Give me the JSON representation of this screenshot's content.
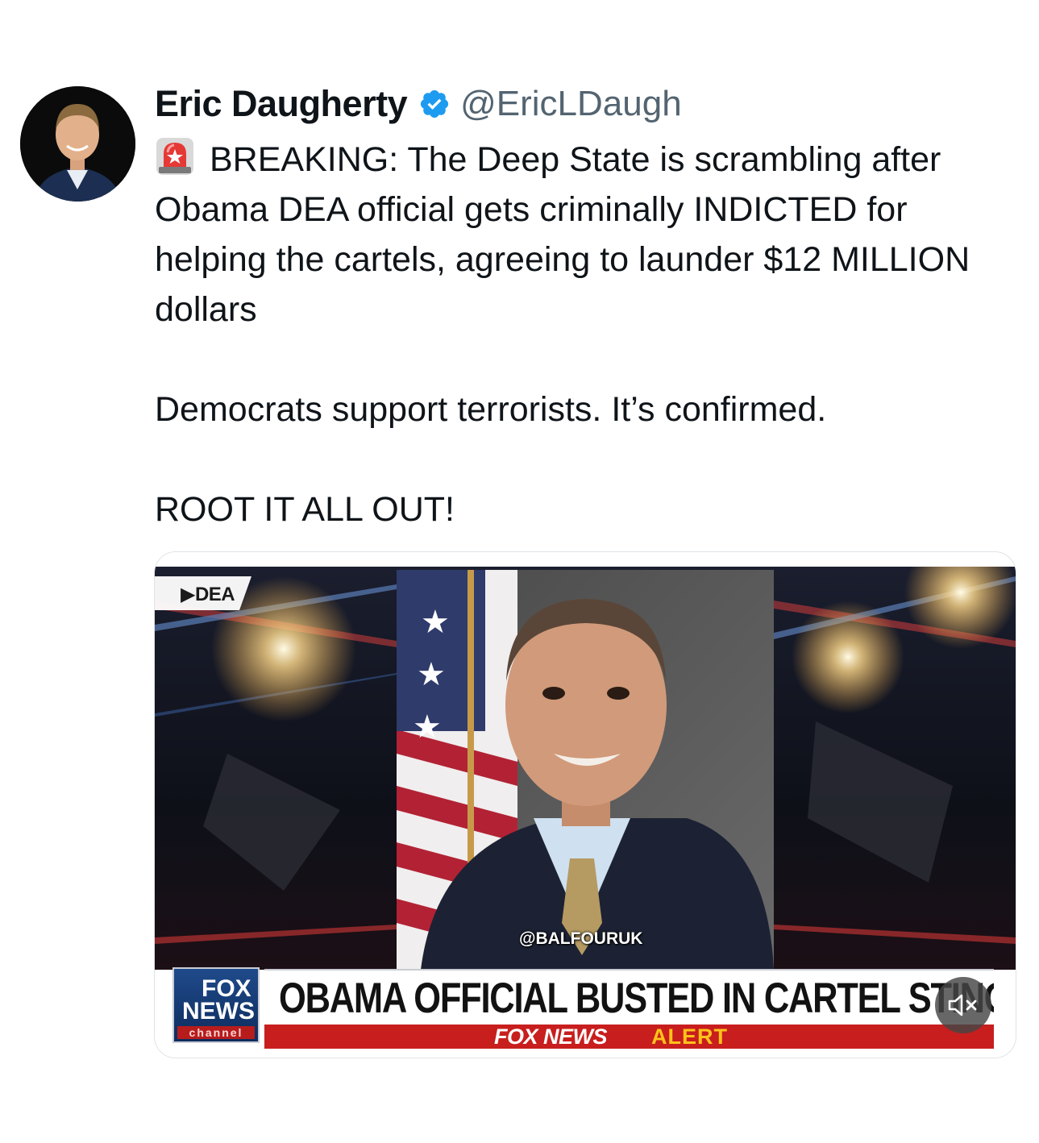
{
  "author": {
    "display_name": "Eric Daugherty",
    "handle": "@EricLDaugh",
    "verified": true
  },
  "tweet": {
    "paragraphs": [
      "BREAKING: The Deep State is scrambling after Obama DEA official gets criminally INDICTED for helping the cartels, agreeing to launder $12 MILLION dollars",
      "Democrats support terrorists. It’s confirmed.",
      "ROOT IT ALL OUT!"
    ],
    "leading_emoji": "police-siren-icon"
  },
  "media": {
    "corner_tag": "DEA",
    "watermark": "@BALFOURUK",
    "logo": {
      "line1": "FOX",
      "line2": "NEWS",
      "line3": "channel"
    },
    "headline": "OBAMA OFFICIAL BUSTED IN CARTEL STING",
    "alert_brand": "FOX NEWS",
    "alert_word": "ALERT",
    "mute_icon": "mute-icon"
  },
  "colors": {
    "verified_badge": "#1d9bf0",
    "handle": "#536471",
    "alert_red": "#c81e1e",
    "alert_yellow": "#ffc21a"
  }
}
